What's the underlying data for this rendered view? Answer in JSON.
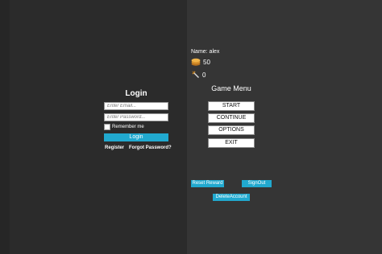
{
  "login": {
    "title": "Login",
    "email_placeholder": "Enter Email...",
    "password_placeholder": "Enter Password...",
    "remember_label": "Remember me",
    "login_label": "Login",
    "register_label": "Register",
    "forgot_label": "Forgot Password?"
  },
  "player": {
    "name_label": "Name: alex",
    "coins": "50",
    "swords": "0"
  },
  "menu": {
    "title": "Game Menu",
    "start": "START",
    "continue": "CONTINUE",
    "options": "OPTIONS",
    "exit": "EXIT"
  },
  "account": {
    "reset_reward": "Reset Reward",
    "sign_out": "SignOut",
    "delete_account": "DeleteAccount"
  },
  "colors": {
    "accent": "#21a9cf",
    "background_left": "#2b2b2b",
    "background_right": "#353535"
  }
}
